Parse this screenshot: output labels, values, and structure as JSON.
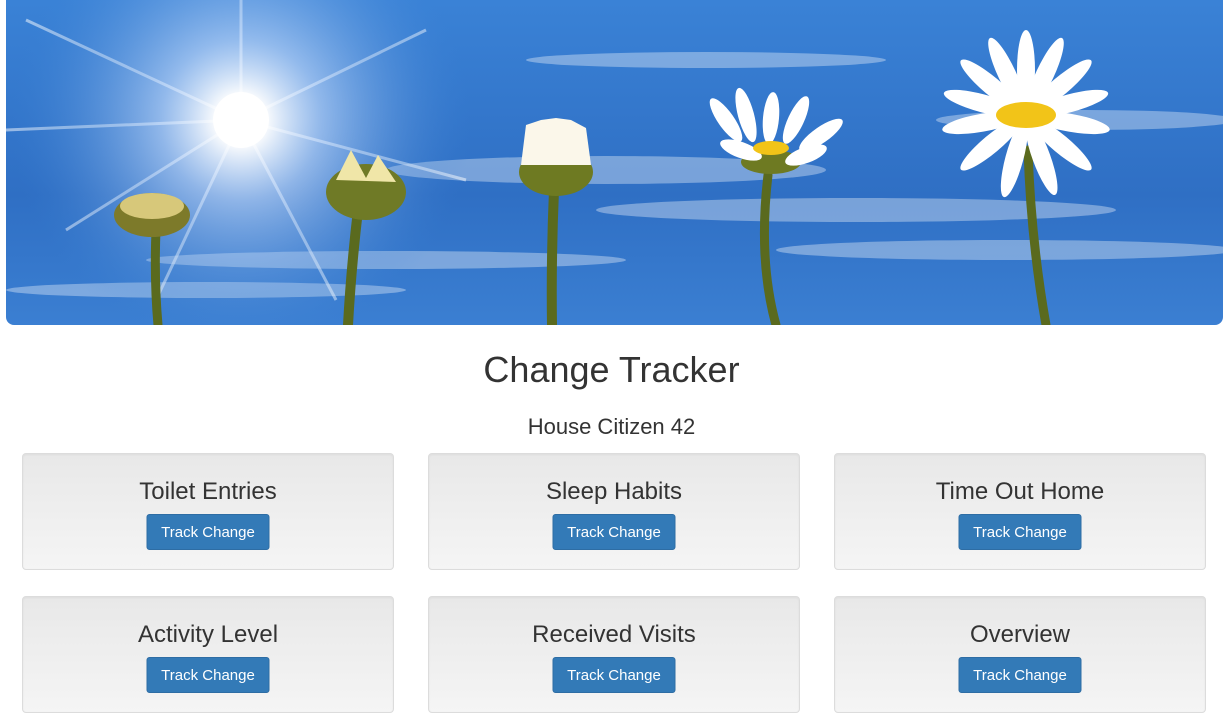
{
  "header": {
    "title": "Change Tracker",
    "subtitle": "House Citizen 42"
  },
  "banner": {
    "description_icon": "daisy-growth-banner",
    "sky_color": "#2f74c9",
    "petal_color": "#ffffff",
    "center_color": "#f2c418"
  },
  "cards": [
    {
      "title": "Toilet Entries",
      "button": "Track Change"
    },
    {
      "title": "Sleep Habits",
      "button": "Track Change"
    },
    {
      "title": "Time Out Home",
      "button": "Track Change"
    },
    {
      "title": "Activity Level",
      "button": "Track Change"
    },
    {
      "title": "Received Visits",
      "button": "Track Change"
    },
    {
      "title": "Overview",
      "button": "Track Change"
    }
  ],
  "colors": {
    "button_bg": "#337ab7",
    "card_bg": "#eeeeee",
    "text": "#333333"
  }
}
